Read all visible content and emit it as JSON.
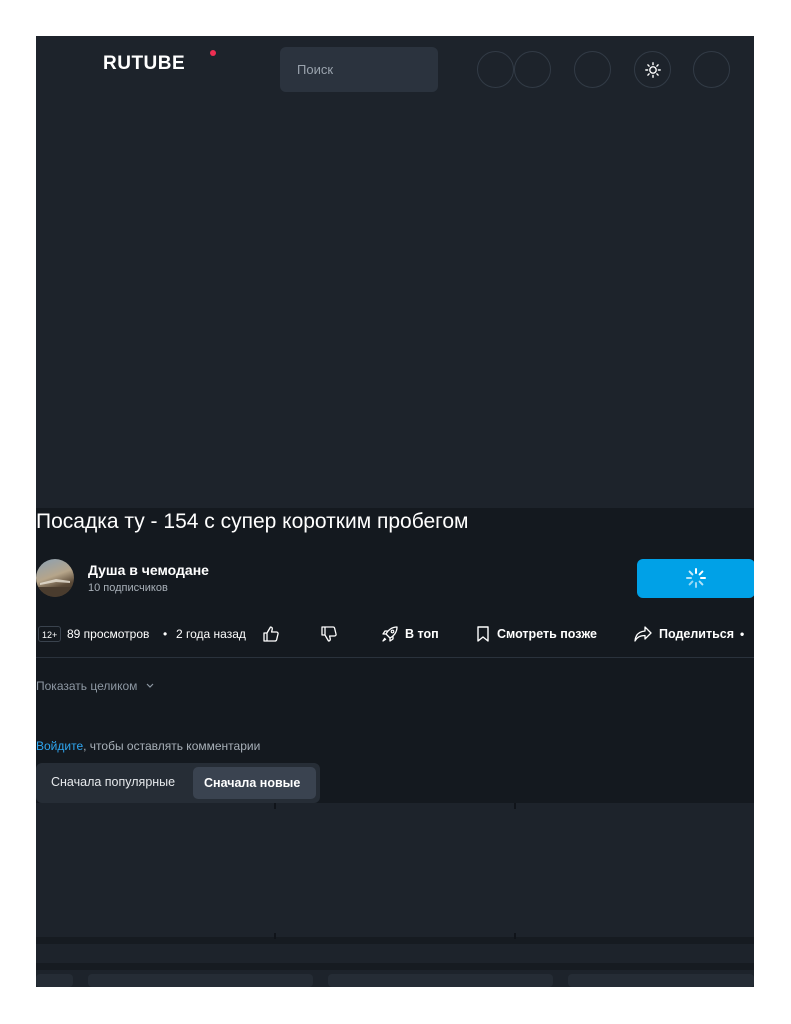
{
  "header": {
    "logo": "RUTUBE",
    "search_placeholder": "Поиск"
  },
  "video": {
    "title": "Посадка ту - 154 с супер коротким пробегом",
    "age_rating": "12+",
    "views": "89 просмотров",
    "dot": "•",
    "date": "2 года назад"
  },
  "channel": {
    "name": "Душа в чемодане",
    "subscribers": "10 подписчиков"
  },
  "actions": {
    "top": "В топ",
    "watch_later": "Смотреть позже",
    "share": "Поделиться",
    "more": "•"
  },
  "description": {
    "show_more": "Показать целиком"
  },
  "comments": {
    "login_link": "Войдите",
    "login_rest": ", чтобы оставлять комментарии",
    "sort_popular": "Сначала популярные",
    "sort_new": "Сначала новые"
  },
  "colors": {
    "accent": "#00a1e7",
    "logo_dot": "#ee2e52",
    "page_bg": "#14191f"
  }
}
